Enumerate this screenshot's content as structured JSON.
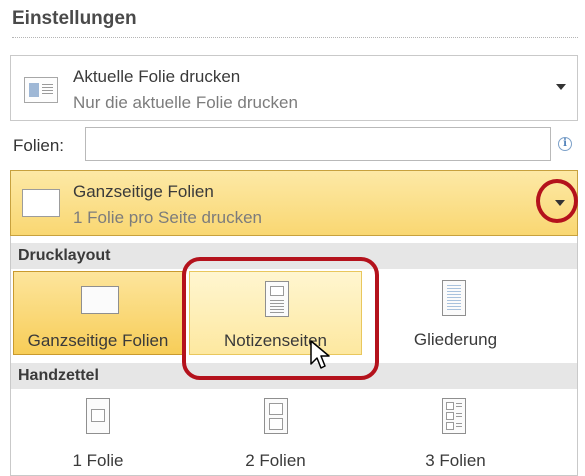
{
  "section": {
    "title": "Einstellungen"
  },
  "print_range": {
    "title": "Aktuelle Folie drucken",
    "subtitle": "Nur die aktuelle Folie drucken",
    "icon": "slide-list-icon"
  },
  "slides": {
    "label": "Folien:",
    "value": "",
    "info_icon": "info-icon",
    "info_glyph": "i"
  },
  "layout": {
    "title": "Ganzseitige Folien",
    "subtitle": "1 Folie pro Seite drucken",
    "icon": "full-page-slide-icon"
  },
  "menu": {
    "layout_header": "Drucklayout",
    "layouts": [
      {
        "label": "Ganzseitige Folien",
        "icon": "full-page-slide-icon",
        "state": "selected"
      },
      {
        "label": "Notizenseiten",
        "icon": "notes-page-icon",
        "state": "hover"
      },
      {
        "label": "Gliederung",
        "icon": "outline-icon",
        "state": "normal"
      }
    ],
    "handouts_header": "Handzettel",
    "handouts": [
      {
        "label": "1 Folie",
        "icon": "one-slide-handout-icon"
      },
      {
        "label": "2 Folien",
        "icon": "two-slides-handout-icon"
      },
      {
        "label": "3 Folien",
        "icon": "three-slides-handout-icon"
      }
    ]
  },
  "colors": {
    "selected_bg": "#f9d772",
    "highlight_red": "#b4121c"
  }
}
